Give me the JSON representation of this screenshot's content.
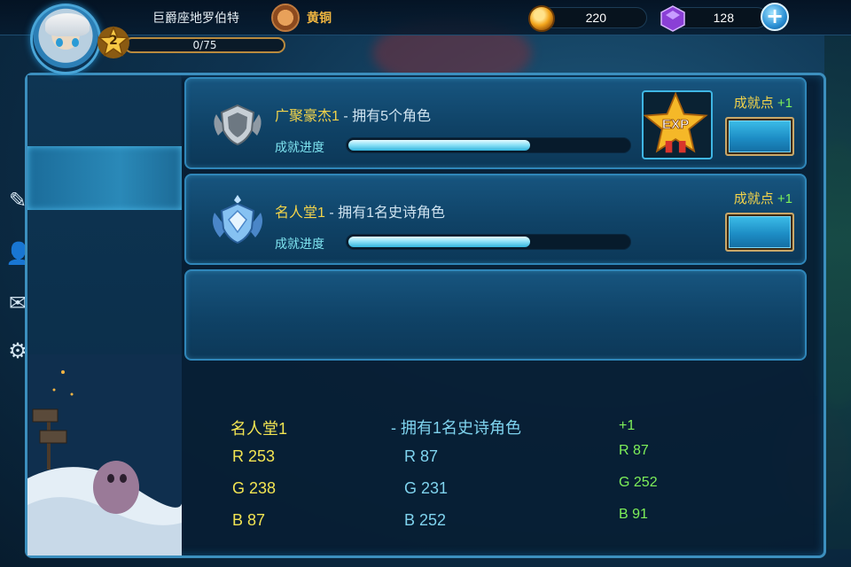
{
  "player": {
    "name": "巨爵座地罗伯特",
    "level": "2",
    "xp_text": "0/75",
    "rank": "黄铜"
  },
  "currency": {
    "coins": "220",
    "gems": "128"
  },
  "achievements": [
    {
      "title": "广聚豪杰1",
      "desc": " - 拥有5个角色",
      "progress_label": "成就进度",
      "progress": 0.65,
      "reward_icon": "exp-star-icon",
      "points_label": "成就点",
      "points": "+1"
    },
    {
      "title": "名人堂1",
      "desc": " - 拥有1名史诗角色",
      "progress_label": "成就进度",
      "progress": 0.65,
      "points_label": "成就点",
      "points": "+1"
    }
  ],
  "info": {
    "col1": {
      "title": "名人堂1",
      "r": "R  253",
      "g": "G  238",
      "b": "B  87"
    },
    "col2": {
      "title": "- 拥有1名史诗角色",
      "r": "R  87",
      "g": "G  231",
      "b": "B  252"
    },
    "col3": {
      "title": "+1",
      "r": "R  87",
      "g": "G  252",
      "b": "B  91"
    }
  },
  "colors": {
    "title_yellow": "#fdee57",
    "desc_cyan": "#57e7fc",
    "points_green": "#57fc5b",
    "panel_border": "#3c8fbe"
  }
}
